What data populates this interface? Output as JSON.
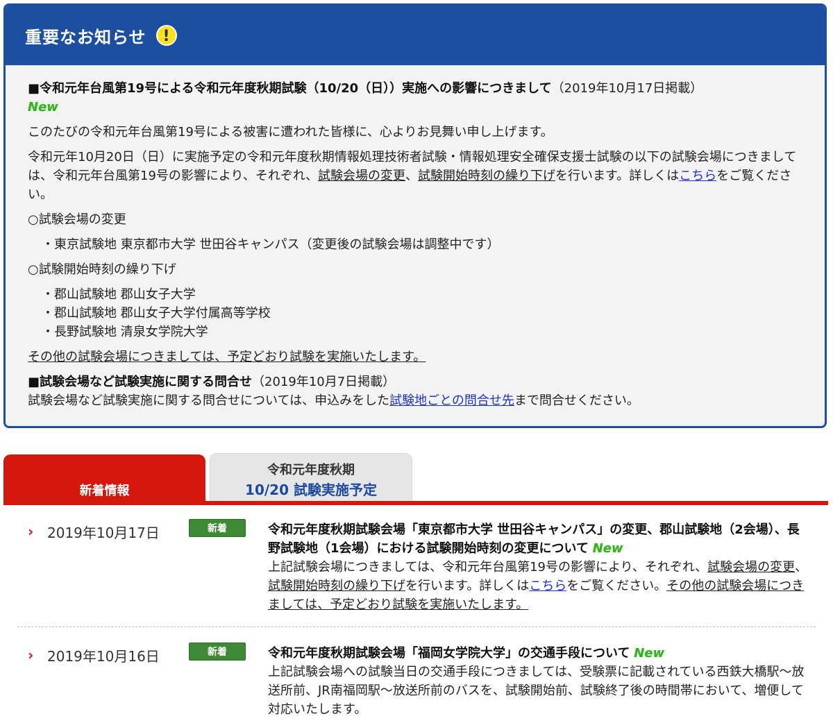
{
  "notice": {
    "title": "重要なお知らせ",
    "icon": "exclamation-icon",
    "heading1": "■令和元年台風第19号による令和元年度秋期試験（10/20（日））実施への影響につきまして",
    "heading1_date": "（2019年10月17日掲載）",
    "new_label": "New",
    "p1": "このたびの令和元年台風第19号による被害に遭われた皆様に、心よりお見舞い申し上げます。",
    "p2_a": "令和元年10月20日（日）に実施予定の令和元年度秋期情報処理技術者試験・情報処理安全確保支援士試験の以下の試験会場につきましては、令和元年台風第19号の影響により、それぞれ、",
    "p2_link1": "試験会場の変更",
    "p2_b": "、",
    "p2_link2": "試験開始時刻の繰り下げ",
    "p2_c": "を行います。詳しくは",
    "p2_link3": "こちら",
    "p2_d": "をご覧ください。",
    "section1": "○試験会場の変更",
    "section1_items": [
      "・東京試験地 東京都市大学 世田谷キャンパス（変更後の試験会場は調整中です）"
    ],
    "section2": "○試験開始時刻の繰り下げ",
    "section2_items": [
      "・郡山試験地 郡山女子大学",
      "・郡山試験地 郡山女子大学付属高等学校",
      "・長野試験地 清泉女学院大学"
    ],
    "other_note": "その他の試験会場につきましては、予定どおり試験を実施いたします。",
    "heading2": "■試験会場など試験実施に関する問合せ",
    "heading2_date": "（2019年10月7日掲載）",
    "p3_a": "試験会場など試験実施に関する問合せについては、申込みをした",
    "p3_link": "試験地ごとの問合せ先",
    "p3_b": "まで問合せください。"
  },
  "tabs": {
    "news": "新着情報",
    "exam_line1": "令和元年度秋期",
    "exam_line2": "10/20 試験実施予定"
  },
  "news": [
    {
      "date": "2019年10月17日",
      "badge": "新着",
      "title": "令和元年度秋期試験会場「東京都市大学 世田谷キャンパス」の変更、郡山試験地（2会場）、長野試験地（1会場）における試験開始時刻の変更について",
      "new_label": "New",
      "body_a": "上記試験会場につきましては、令和元年台風第19号の影響により、それぞれ、",
      "body_link1": "試験会場の変更",
      "body_b": "、",
      "body_link2": "試験開始時刻の繰り下げ",
      "body_c": "を行います。詳しくは",
      "body_link3": "こちら",
      "body_d": "をご覧ください。",
      "body_e": "その他の試験会場につきましては、予定どおり試験を実施いたします。"
    },
    {
      "date": "2019年10月16日",
      "badge": "新着",
      "title": "令和元年度秋期試験会場「福岡女学院大学」の交通手段について",
      "new_label": "New",
      "body": "上記試験会場への試験当日の交通手段につきましては、受験票に記載されている西鉄大橋駅〜放送所前、JR南福岡駅〜放送所前のバスを、試験開始前、試験終了後の時間帯において、増便して対応いたします。"
    }
  ]
}
